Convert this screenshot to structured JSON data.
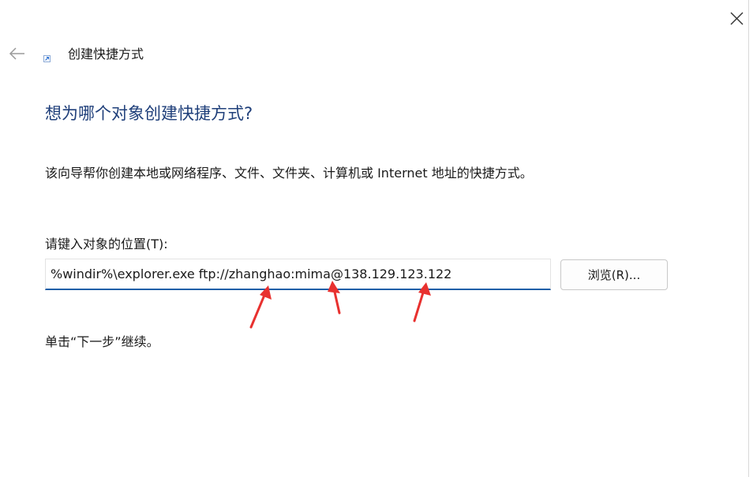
{
  "window": {
    "title": "创建快捷方式",
    "close_icon": "close-icon",
    "back_icon": "back-arrow-icon",
    "shortcut_icon": "shortcut-icon"
  },
  "wizard": {
    "heading": "想为哪个对象创建快捷方式?",
    "description": "该向导帮你创建本地或网络程序、文件、文件夹、计算机或 Internet 地址的快捷方式。",
    "location_label": "请键入对象的位置(T):",
    "location_value": "%windir%\\explorer.exe ftp://zhanghao:mima@138.129.123.122",
    "browse_label": "浏览(R)...",
    "hint": "单击“下一步”继续。"
  },
  "colors": {
    "heading": "#1f3f7a",
    "input_underline": "#1f5fa8",
    "annotation_arrow": "#e8312f"
  }
}
